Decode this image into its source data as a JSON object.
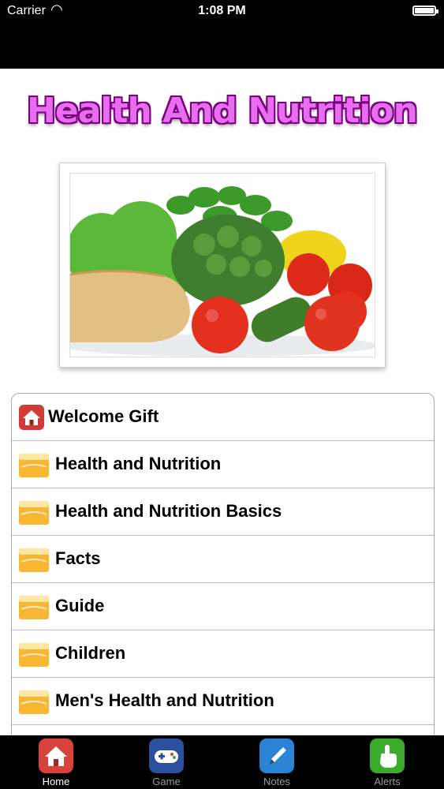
{
  "status_bar": {
    "carrier": "Carrier",
    "time": "1:08 PM"
  },
  "title": "Health And Nutrition",
  "menu": [
    {
      "label": "Welcome Gift",
      "icon": "home-icon"
    },
    {
      "label": "Health and Nutrition",
      "icon": "juice-icon"
    },
    {
      "label": "Health and Nutrition Basics",
      "icon": "juice-icon"
    },
    {
      "label": "Facts",
      "icon": "juice-icon"
    },
    {
      "label": "Guide",
      "icon": "juice-icon"
    },
    {
      "label": "Children",
      "icon": "juice-icon"
    },
    {
      "label": "Men's Health and Nutrition",
      "icon": "juice-icon"
    }
  ],
  "tabs": [
    {
      "label": "Home",
      "icon": "home-icon",
      "color": "#d9423a"
    },
    {
      "label": "Game",
      "icon": "gamepad-icon",
      "color": "#2c4f9e"
    },
    {
      "label": "Notes",
      "icon": "pen-icon",
      "color": "#2b83d6"
    },
    {
      "label": "Alerts",
      "icon": "hand-icon",
      "color": "#3caa2a"
    }
  ],
  "active_tab": "Home"
}
